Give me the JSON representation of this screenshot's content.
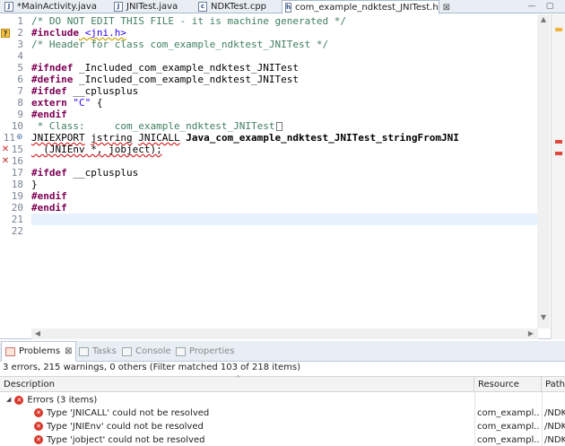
{
  "editor_tabs": [
    {
      "label": "*MainActivity.java",
      "icon": "java-file-icon",
      "glyph": "J"
    },
    {
      "label": "JNITest.java",
      "icon": "java-file-icon",
      "glyph": "J"
    },
    {
      "label": "NDKTest.cpp",
      "icon": "cpp-file-icon",
      "glyph": "c"
    },
    {
      "label": "com_example_ndktest_JNITest.h",
      "icon": "header-file-icon",
      "glyph": "h",
      "active": true,
      "close": "⊠"
    }
  ],
  "window_controls": {
    "minimize": "—",
    "maximize": "▢"
  },
  "editor": {
    "line_numbers": [
      "1",
      "2",
      "3",
      "4",
      "5",
      "6",
      "7",
      "8",
      "9",
      "10",
      "11",
      "15",
      "16",
      "17",
      "18",
      "19",
      "20",
      "21",
      "22"
    ],
    "lines": [
      {
        "num": "1",
        "text": "/* DO NOT EDIT THIS FILE - it is machine generated */"
      },
      {
        "num": "2",
        "kw": "#include",
        "rest": " <jni.h>"
      },
      {
        "num": "3",
        "text": "/* Header for class com_example_ndktest_JNITest */"
      },
      {
        "num": "4",
        "text": ""
      },
      {
        "num": "5",
        "kw": "#ifndef",
        "rest": " _Included_com_example_ndktest_JNITest"
      },
      {
        "num": "6",
        "kw": "#define",
        "rest": " _Included_com_example_ndktest_JNITest"
      },
      {
        "num": "7",
        "kw": "#ifdef",
        "rest": " __cplusplus"
      },
      {
        "num": "8",
        "kw": "extern",
        "str": " \"C\"",
        "rest": " {"
      },
      {
        "num": "9",
        "kw": "#endif",
        "rest": ""
      },
      {
        "num": "11",
        "text": " * Class:     com_example_ndktest_JNITest"
      },
      {
        "num": "15",
        "a": "JNIEXPORT",
        "b": "jstring",
        "c": "JNICALL",
        "fn": "Java_com_example_ndktest_JNITest_stringFromJNI"
      },
      {
        "num": "16",
        "text": "  (JNIEnv *, jobject);"
      },
      {
        "num": "17",
        "text": ""
      },
      {
        "num": "18",
        "kw": "#ifdef",
        "rest": " __cplusplus"
      },
      {
        "num": "19",
        "text": "}"
      },
      {
        "num": "20",
        "kw": "#endif",
        "rest": ""
      },
      {
        "num": "21",
        "kw": "#endif",
        "rest": ""
      },
      {
        "num": "22",
        "text": ""
      }
    ],
    "fold_marker": "⊕",
    "warning_marker": "?"
  },
  "problems_view": {
    "tabs": [
      {
        "label": "Problems",
        "active": true,
        "close": "⊠"
      },
      {
        "label": "Tasks"
      },
      {
        "label": "Console"
      },
      {
        "label": "Properties"
      }
    ],
    "summary": "3 errors, 215 warnings, 0 others (Filter matched 103 of 218 items)",
    "columns": [
      "Description",
      "Resource",
      "Path"
    ],
    "group": {
      "label": "Errors (3 items)"
    },
    "rows": [
      {
        "description": "Type 'JNICALL' could not be resolved",
        "resource": "com_exampl...",
        "path": "/NDK"
      },
      {
        "description": "Type 'JNIEnv' could not be resolved",
        "resource": "com_exampl...",
        "path": "/NDK"
      },
      {
        "description": "Type 'jobject' could not be resolved",
        "resource": "com_exampl...",
        "path": "/NDK"
      }
    ]
  },
  "colors": {
    "comment": "#3f7f5f",
    "keyword": "#7f0055",
    "string": "#2a00ff",
    "error": "#d9382b",
    "current_line": "#e8f2fe"
  }
}
